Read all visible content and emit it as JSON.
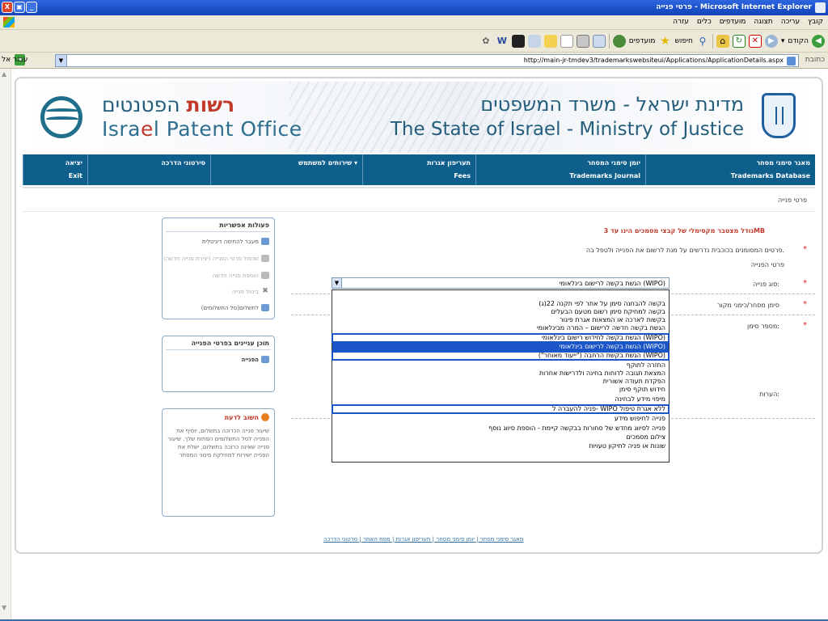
{
  "window": {
    "title": "פרטי פנייה - Microsoft Internet Explorer",
    "controls": {
      "close": "X",
      "maximize": "▣",
      "minimize": "_"
    }
  },
  "menu": {
    "items": [
      "קובץ",
      "עריכה",
      "תצוגה",
      "מועדפים",
      "כלים",
      "עזרה"
    ]
  },
  "toolbar": {
    "back_label": "הקודם",
    "search_label": "חיפוש",
    "favorites_label": "מועדפים"
  },
  "address": {
    "label": "כתובת",
    "url": "http://main-jr-tmdev3/trademarkswebsiteui/Applications/ApplicationDetails.aspx",
    "go_label": "עבור אל"
  },
  "banner": {
    "org_he_highlight": "רשות",
    "org_he_rest": " הפטנטים",
    "org_en_part1": "Isra",
    "org_en_highlight": "e",
    "org_en_part2": "l Patent Office",
    "state_he": "מדינת ישראל - משרד המשפטים",
    "state_en": "The State of Israel - Ministry of Justice"
  },
  "nav": [
    {
      "he": "מאגר סימני מסחר",
      "en": "Trademarks Database"
    },
    {
      "he": "יומן סימני המסחר",
      "en": "Trademarks Journal"
    },
    {
      "he": "תעריפון אגרות",
      "en": "Fees"
    },
    {
      "he": "שירותים למשתמש ▾",
      "en": ""
    },
    {
      "he": "סירטוני הדרכה",
      "en": ""
    },
    {
      "he": "יציאה",
      "en": "Exit"
    }
  ],
  "breadcrumb": "פרטי פנייה",
  "form": {
    "max_size_note": "גודל מצטבר מקסימלי של קבצי מסמכים הינו עד 3MB",
    "required_note": "פרטים המסומנים בכוכבית נדרשים על מנת לרשום את הפנייה ולטפל בה.",
    "section_title": "פרטי הפנייה",
    "fields": {
      "request_type": "סוג פנייה:",
      "mark_source": "סימן מסחר/כימני מקור",
      "mark_number": "מספר סימן:",
      "notes": "הערות:"
    },
    "request_type_value": "הגשת בקשה לרישום בינלאומי (WIPO)",
    "options": [
      "בקשה להבחנה סימן על אתר לפי תקנה 22(ג)",
      "בקשה למחיקת סימן רשום מטעם הבעלים",
      "בקשות לארכה או המצאות אגרת פיגור",
      "הגשת בקשה חדשה לרישום – המרה מבינלאומי",
      "הגשת בקשה לחידוש רישום בינלאומי (WIPO)",
      "הגשת בקשה לרישום בינלאומי (WIPO)",
      "הגשת בקשת הרחבה (\"ייעוד מאוחר\") (WIPO)",
      "החזרה לתוקף",
      "המצאת תגובה לדוחות בחינה ולדרישות אחרות",
      "הפקדת תעודה אשורית",
      "חידוש תוקף סימן",
      "מיפוי מידע לבחינה",
      "פניה להעברה ל- WIPO ללא אגרת טיפול",
      "פנייה לחיפוש מידע",
      "פנייה לסיווג מחדש של סחורות בבקשה קיימת - הוספת סיווג נוסף",
      "צילום מסמכים",
      "שונות או פניה לתיקון טעויות"
    ]
  },
  "sidebar": {
    "actions_title": "פעולות אפשריות",
    "actions": [
      "מעבר להתימה דיגיטלית",
      "שכפול פרטי הפנייה (יצירת פנייה חדשה)",
      "הוספת פנייה חדשה",
      "ביטול פנייה",
      "לתשלום(סל התשלומים)"
    ],
    "contents_title": "תוכן עניינים בפרטי הפנייה",
    "contents_items": [
      "הפנייה"
    ],
    "notice_title": "חשוב לדעת",
    "notice_text": "שיעור פנייה הכרוכה בתשלום, יוסיף את הפנייה לסל התשלומים הפתוח שלך. שיעור פנייה שאינה כרוכה בתשלום, ישלח את הפנייה ישירות למחלקת סימני המסחר"
  },
  "footer": "מאגר סימני מסחר | יומן סימני מסחר | תעריפון אגרות | מפת האתר | סרטוני הדרכה"
}
